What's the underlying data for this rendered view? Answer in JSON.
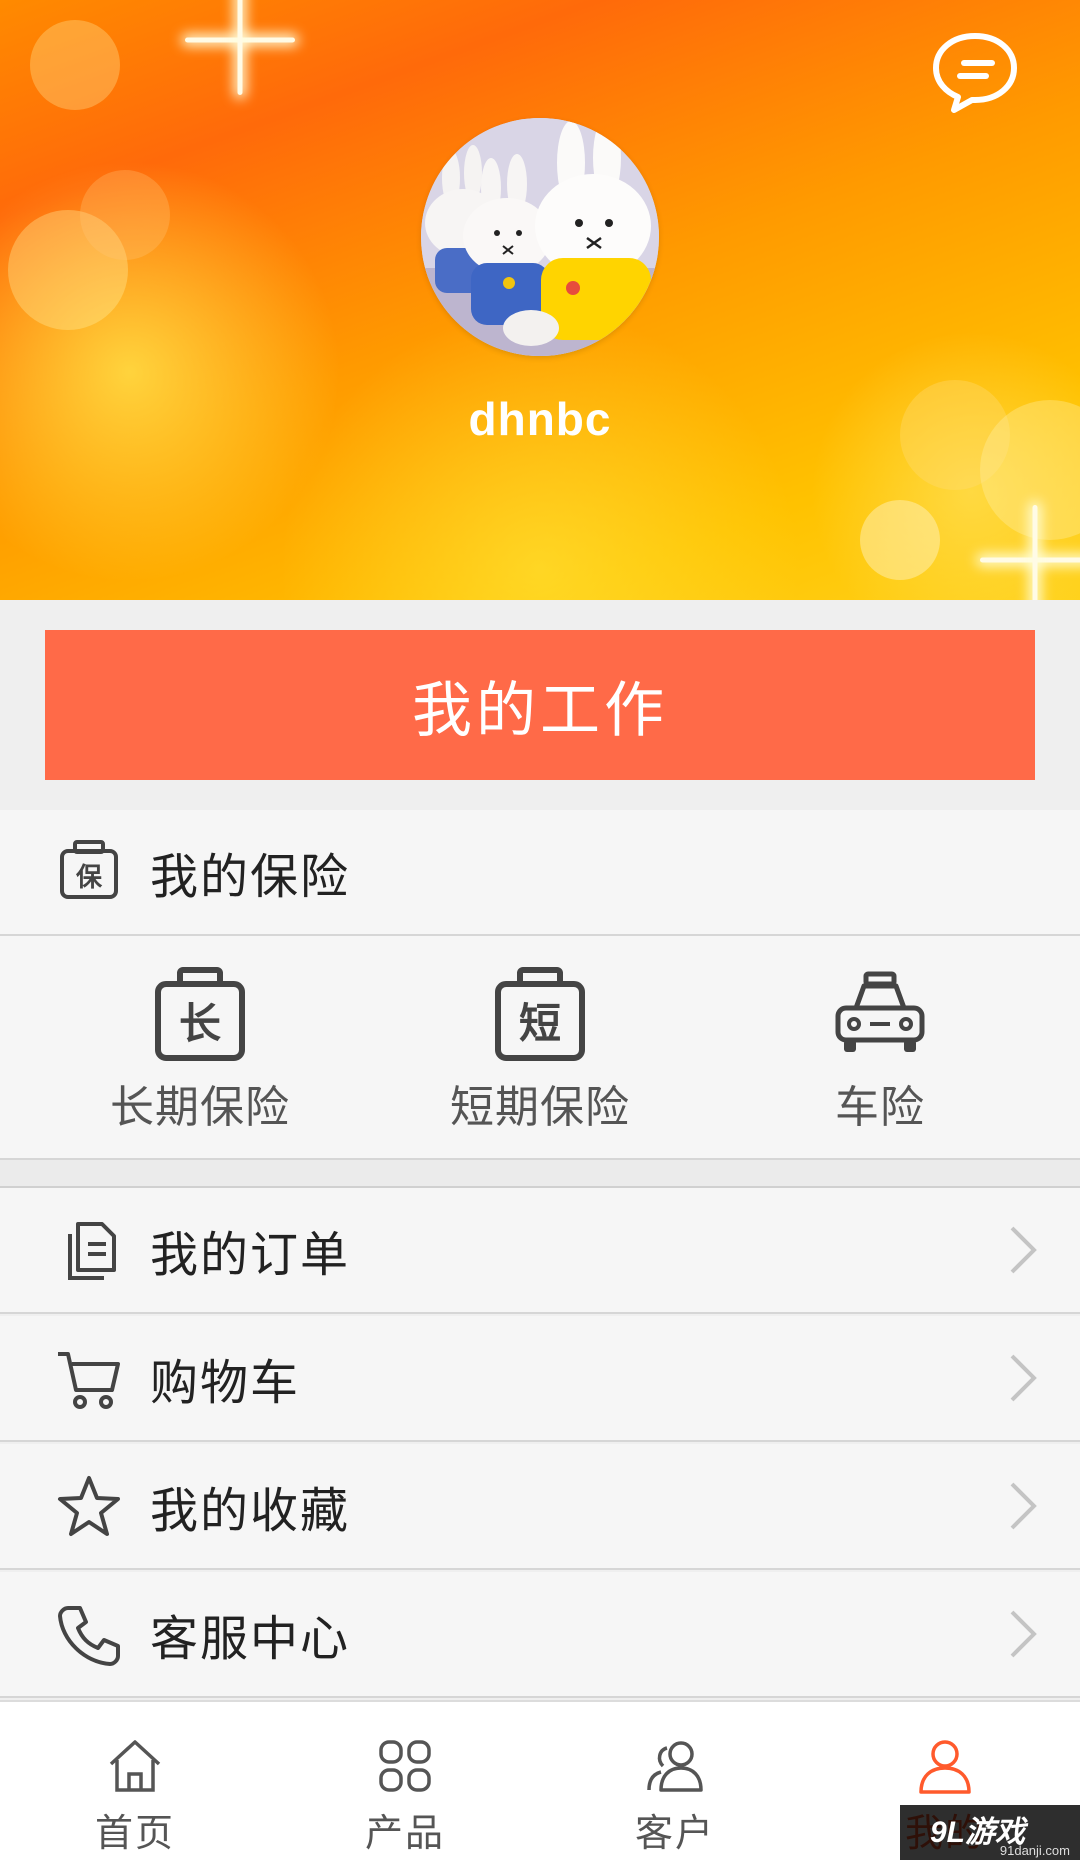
{
  "profile": {
    "username": "dhnbc",
    "avatar_icon": "bunny-plush-avatar",
    "message_icon": "chat-bubble-icon"
  },
  "work_button": {
    "label": "我的工作",
    "color": "#ff6a48"
  },
  "insurance": {
    "title": "我的保险",
    "icon": "insurance-bag-icon",
    "items": [
      {
        "label": "长期保险",
        "icon": "long-term-bag-icon",
        "glyph": "长"
      },
      {
        "label": "短期保险",
        "icon": "short-term-bag-icon",
        "glyph": "短"
      },
      {
        "label": "车险",
        "icon": "car-icon"
      }
    ],
    "header_glyph": "保"
  },
  "menu": [
    {
      "label": "我的订单",
      "icon": "document-icon"
    },
    {
      "label": "购物车",
      "icon": "cart-icon"
    },
    {
      "label": "我的收藏",
      "icon": "star-icon"
    },
    {
      "label": "客服中心",
      "icon": "phone-icon"
    }
  ],
  "bottom_nav": {
    "items": [
      {
        "label": "首页",
        "icon": "home-icon"
      },
      {
        "label": "产品",
        "icon": "grid-icon"
      },
      {
        "label": "客户",
        "icon": "users-icon"
      },
      {
        "label": "我的",
        "icon": "user-icon",
        "active": true
      }
    ],
    "active_color": "#ff5a2c"
  },
  "watermark": {
    "main": "9L游戏",
    "sub": "91danji.com"
  }
}
